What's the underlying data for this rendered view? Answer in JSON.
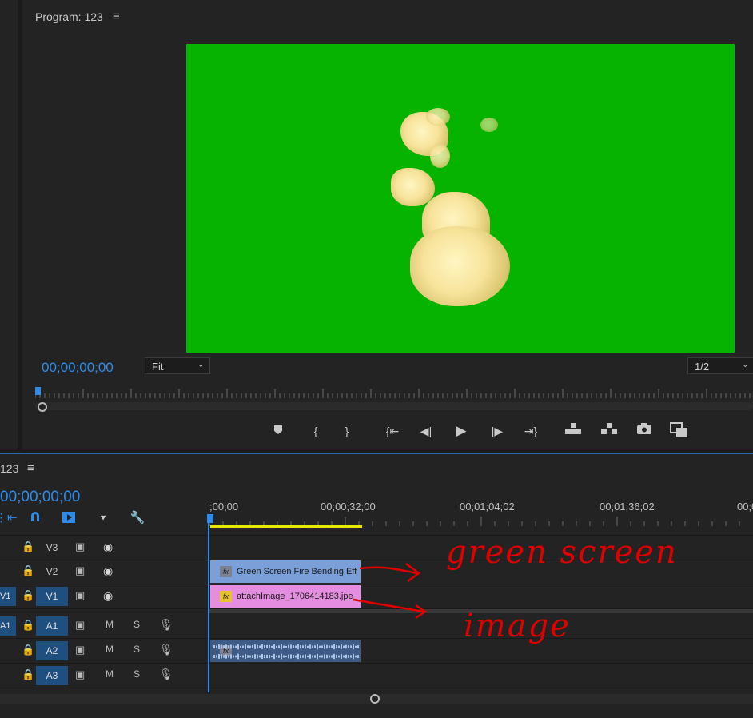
{
  "program_monitor": {
    "title": "Program: 123",
    "menu_icon": "hamburger-icon",
    "timecode": "00;00;00;00",
    "fit_label": "Fit",
    "resolution_label": "1/2",
    "frame_background": "#06b400",
    "transport_icons": [
      "marker-icon",
      "mark-in-icon",
      "mark-out-icon",
      "go-to-in-icon",
      "step-back-icon",
      "play-icon",
      "step-forward-icon",
      "go-to-out-icon",
      "lift-icon",
      "extract-icon",
      "export-frame-icon",
      "multicam-icon"
    ]
  },
  "timeline": {
    "sequence_name": "123",
    "menu_icon": "hamburger-icon",
    "timecode": "00;00;00;00",
    "ruler_labels": [
      ";00;00",
      "00;00;32;00",
      "00;01;04;02",
      "00;01;36;02",
      "00;0"
    ],
    "tracks": [
      {
        "name": "V3",
        "kind": "video",
        "lock": "🔒",
        "toggle": "▣",
        "eye": "👁"
      },
      {
        "name": "V2",
        "kind": "video",
        "lock": "🔒",
        "toggle": "▣",
        "eye": "👁"
      },
      {
        "name": "V1",
        "kind": "video",
        "source_patch": "V1",
        "lock": "🔒",
        "toggle": "▣",
        "eye": "👁"
      },
      {
        "name": "A1",
        "kind": "audio",
        "source_patch": "A1",
        "m": "M",
        "s": "S"
      },
      {
        "name": "A2",
        "kind": "audio",
        "m": "M",
        "s": "S"
      },
      {
        "name": "A3",
        "kind": "audio",
        "m": "M",
        "s": "S"
      }
    ],
    "clips": {
      "v2_clip": {
        "label": "Green Screen Fire Bending Eff",
        "color": "#7b9fd8"
      },
      "v1_clip": {
        "label": "attachImage_1706414183.jpe",
        "color": "#e58de0"
      },
      "a2_clip": {
        "color": "#3d5b84"
      }
    }
  },
  "annotations": {
    "green_screen_note": "green screen",
    "image_note": "image"
  }
}
